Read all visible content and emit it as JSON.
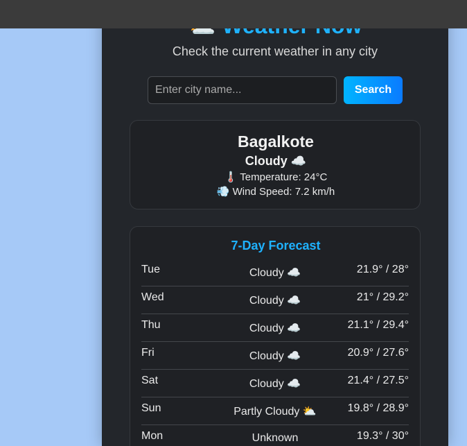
{
  "header": {
    "title_emoji": "⛅",
    "title": "Weather Now",
    "subtitle": "Check the current weather in any city"
  },
  "search": {
    "placeholder": "Enter city name...",
    "value": "",
    "button_label": "Search"
  },
  "current": {
    "city": "Bagalkote",
    "condition": "Cloudy",
    "condition_emoji": "☁️",
    "temperature_emoji": "🌡️",
    "temperature_text": "Temperature: 24°C",
    "wind_emoji": "💨",
    "wind_text": "Wind Speed: 7.2 km/h"
  },
  "forecast": {
    "title": "7-Day Forecast",
    "days": [
      {
        "day": "Tue",
        "condition": "Cloudy",
        "emoji": "☁️",
        "range": "21.9° / 28°"
      },
      {
        "day": "Wed",
        "condition": "Cloudy",
        "emoji": "☁️",
        "range": "21° / 29.2°"
      },
      {
        "day": "Thu",
        "condition": "Cloudy",
        "emoji": "☁️",
        "range": "21.1° / 29.4°"
      },
      {
        "day": "Fri",
        "condition": "Cloudy",
        "emoji": "☁️",
        "range": "20.9° / 27.6°"
      },
      {
        "day": "Sat",
        "condition": "Cloudy",
        "emoji": "☁️",
        "range": "21.4° / 27.5°"
      },
      {
        "day": "Sun",
        "condition": "Partly Cloudy",
        "emoji": "⛅",
        "range": "19.8° / 28.9°"
      },
      {
        "day": "Mon",
        "condition": "Unknown",
        "emoji": "",
        "range": "19.3° / 30°"
      }
    ]
  },
  "colors": {
    "accent": "#1fb2ff",
    "button_gradient_start": "#00b4ff",
    "button_gradient_end": "#0a7bff",
    "panel": "#23262b",
    "page_background": "#a6c9f7"
  }
}
